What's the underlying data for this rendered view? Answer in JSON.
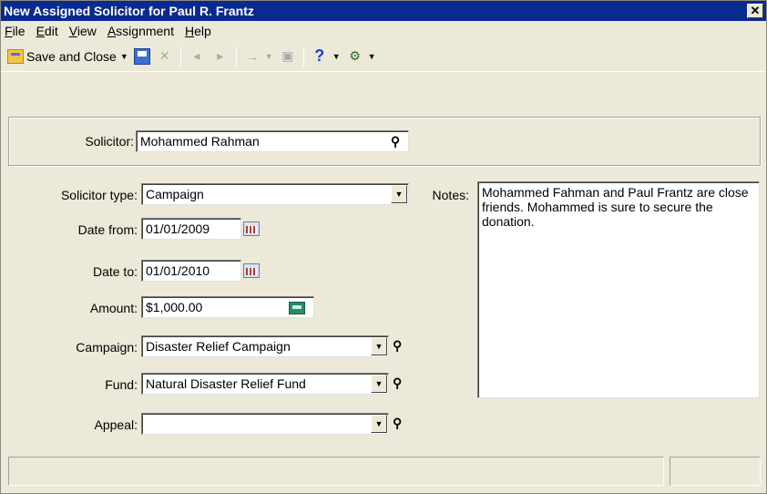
{
  "window": {
    "title": "New Assigned Solicitor for Paul R. Frantz",
    "close_label": "✕"
  },
  "menu": [
    {
      "label": "File",
      "key": "F"
    },
    {
      "label": "Edit",
      "key": "E"
    },
    {
      "label": "View",
      "key": "V"
    },
    {
      "label": "Assignment",
      "key": "A"
    },
    {
      "label": "Help",
      "key": "H"
    }
  ],
  "toolbar": {
    "save_close_label": "Save and Close",
    "icons": [
      "save-icon",
      "delete-icon",
      "previous-icon",
      "next-icon",
      "go-to-icon",
      "properties-icon",
      "help-icon",
      "tools-icon"
    ]
  },
  "form": {
    "solicitor_label": "Solicitor:",
    "solicitor_value": "Mohammed Rahman",
    "solicitor_type_label": "Solicitor type:",
    "solicitor_type_value": "Campaign",
    "date_from_label": "Date from:",
    "date_from_value": "01/01/2009",
    "date_to_label": "Date to:",
    "date_to_value": "01/01/2010",
    "amount_label": "Amount:",
    "amount_value": "$1,000.00",
    "campaign_label": "Campaign:",
    "campaign_value": "Disaster Relief Campaign",
    "fund_label": "Fund:",
    "fund_value": "Natural Disaster Relief Fund",
    "appeal_label": "Appeal:",
    "appeal_value": "",
    "notes_label": "Notes:",
    "notes_value": "Mohammed Fahman and Paul Frantz are close friends. Mohammed is sure to secure the donation."
  }
}
